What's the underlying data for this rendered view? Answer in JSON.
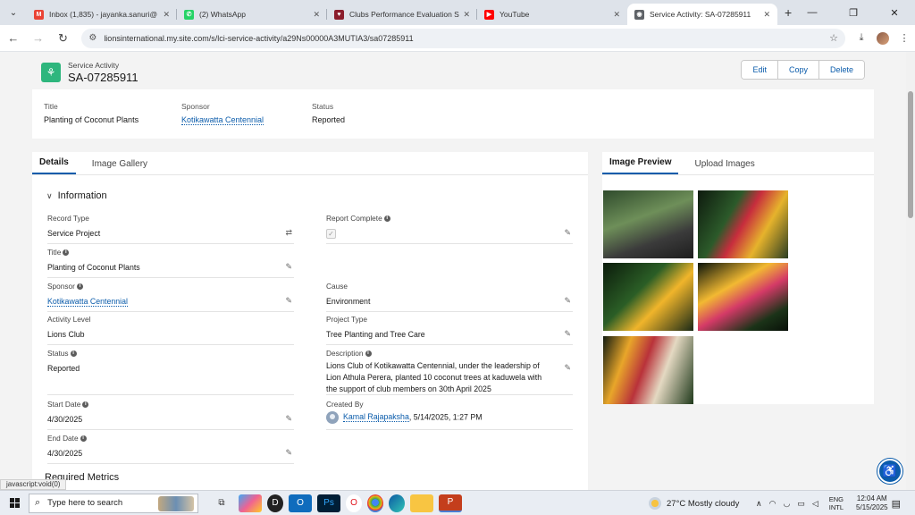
{
  "browser": {
    "tabs": [
      {
        "label": "Inbox (1,835) - jayanka.sanuri@",
        "favicon_color": "#ea4335",
        "favicon": "M"
      },
      {
        "label": "(2) WhatsApp",
        "favicon_color": "#25d366",
        "favicon": "✆"
      },
      {
        "label": "Clubs Performance Evaluation S",
        "favicon_color": "#8b1d2c",
        "favicon": "♥"
      },
      {
        "label": "YouTube",
        "favicon_color": "#ff0000",
        "favicon": "▶"
      },
      {
        "label": "Service Activity: SA-07285911",
        "favicon_color": "#5f6368",
        "favicon": "◉"
      }
    ],
    "url": "lionsinternational.my.site.com/s/lci-service-activity/a29Ns00000A3MUTIA3/sa07285911",
    "status_text": "javascript:void(0)"
  },
  "record": {
    "object_type": "Service Activity",
    "name": "SA-07285911",
    "actions": [
      "Edit",
      "Copy",
      "Delete"
    ],
    "highlights": {
      "title_label": "Title",
      "title_value": "Planting of Coconut Plants",
      "sponsor_label": "Sponsor",
      "sponsor_value": "Kotikawatta Centennial",
      "status_label": "Status",
      "status_value": "Reported"
    }
  },
  "details": {
    "tabs": [
      "Details",
      "Image Gallery"
    ],
    "section_title": "Information",
    "fields": {
      "record_type": {
        "label": "Record Type",
        "value": "Service Project"
      },
      "report_complete": {
        "label": "Report Complete",
        "checked": true
      },
      "title": {
        "label": "Title",
        "value": "Planting of Coconut Plants"
      },
      "sponsor": {
        "label": "Sponsor",
        "value": "Kotikawatta Centennial"
      },
      "cause": {
        "label": "Cause",
        "value": "Environment"
      },
      "activity_level": {
        "label": "Activity Level",
        "value": "Lions Club"
      },
      "project_type": {
        "label": "Project Type",
        "value": "Tree Planting and Tree Care"
      },
      "status": {
        "label": "Status",
        "value": "Reported"
      },
      "description": {
        "label": "Description",
        "value": "Lions Club of Kotikawatta Centennial, under the leadership of Lion Athula Perera, planted 10 coconut trees at kaduwela with the support of club members on 30th April 2025"
      },
      "start_date": {
        "label": "Start Date",
        "value": "4/30/2025"
      },
      "created_by": {
        "label": "Created By",
        "user": "Kamal Rajapaksha",
        "when": ", 5/14/2025, 1:27 PM"
      },
      "end_date": {
        "label": "End Date",
        "value": "4/30/2025"
      }
    },
    "next_section_title": "Required Metrics"
  },
  "images": {
    "tabs": [
      "Image Preview",
      "Upload Images"
    ]
  },
  "taskbar": {
    "search_placeholder": "Type here to search",
    "weather": "27°C  Mostly cloudy",
    "lang_line1": "ENG",
    "lang_line2": "INTL",
    "time": "12:04 AM",
    "date": "5/15/2025"
  },
  "colors": {
    "accent": "#0b5cab",
    "record_icon": "#2eb67d"
  }
}
